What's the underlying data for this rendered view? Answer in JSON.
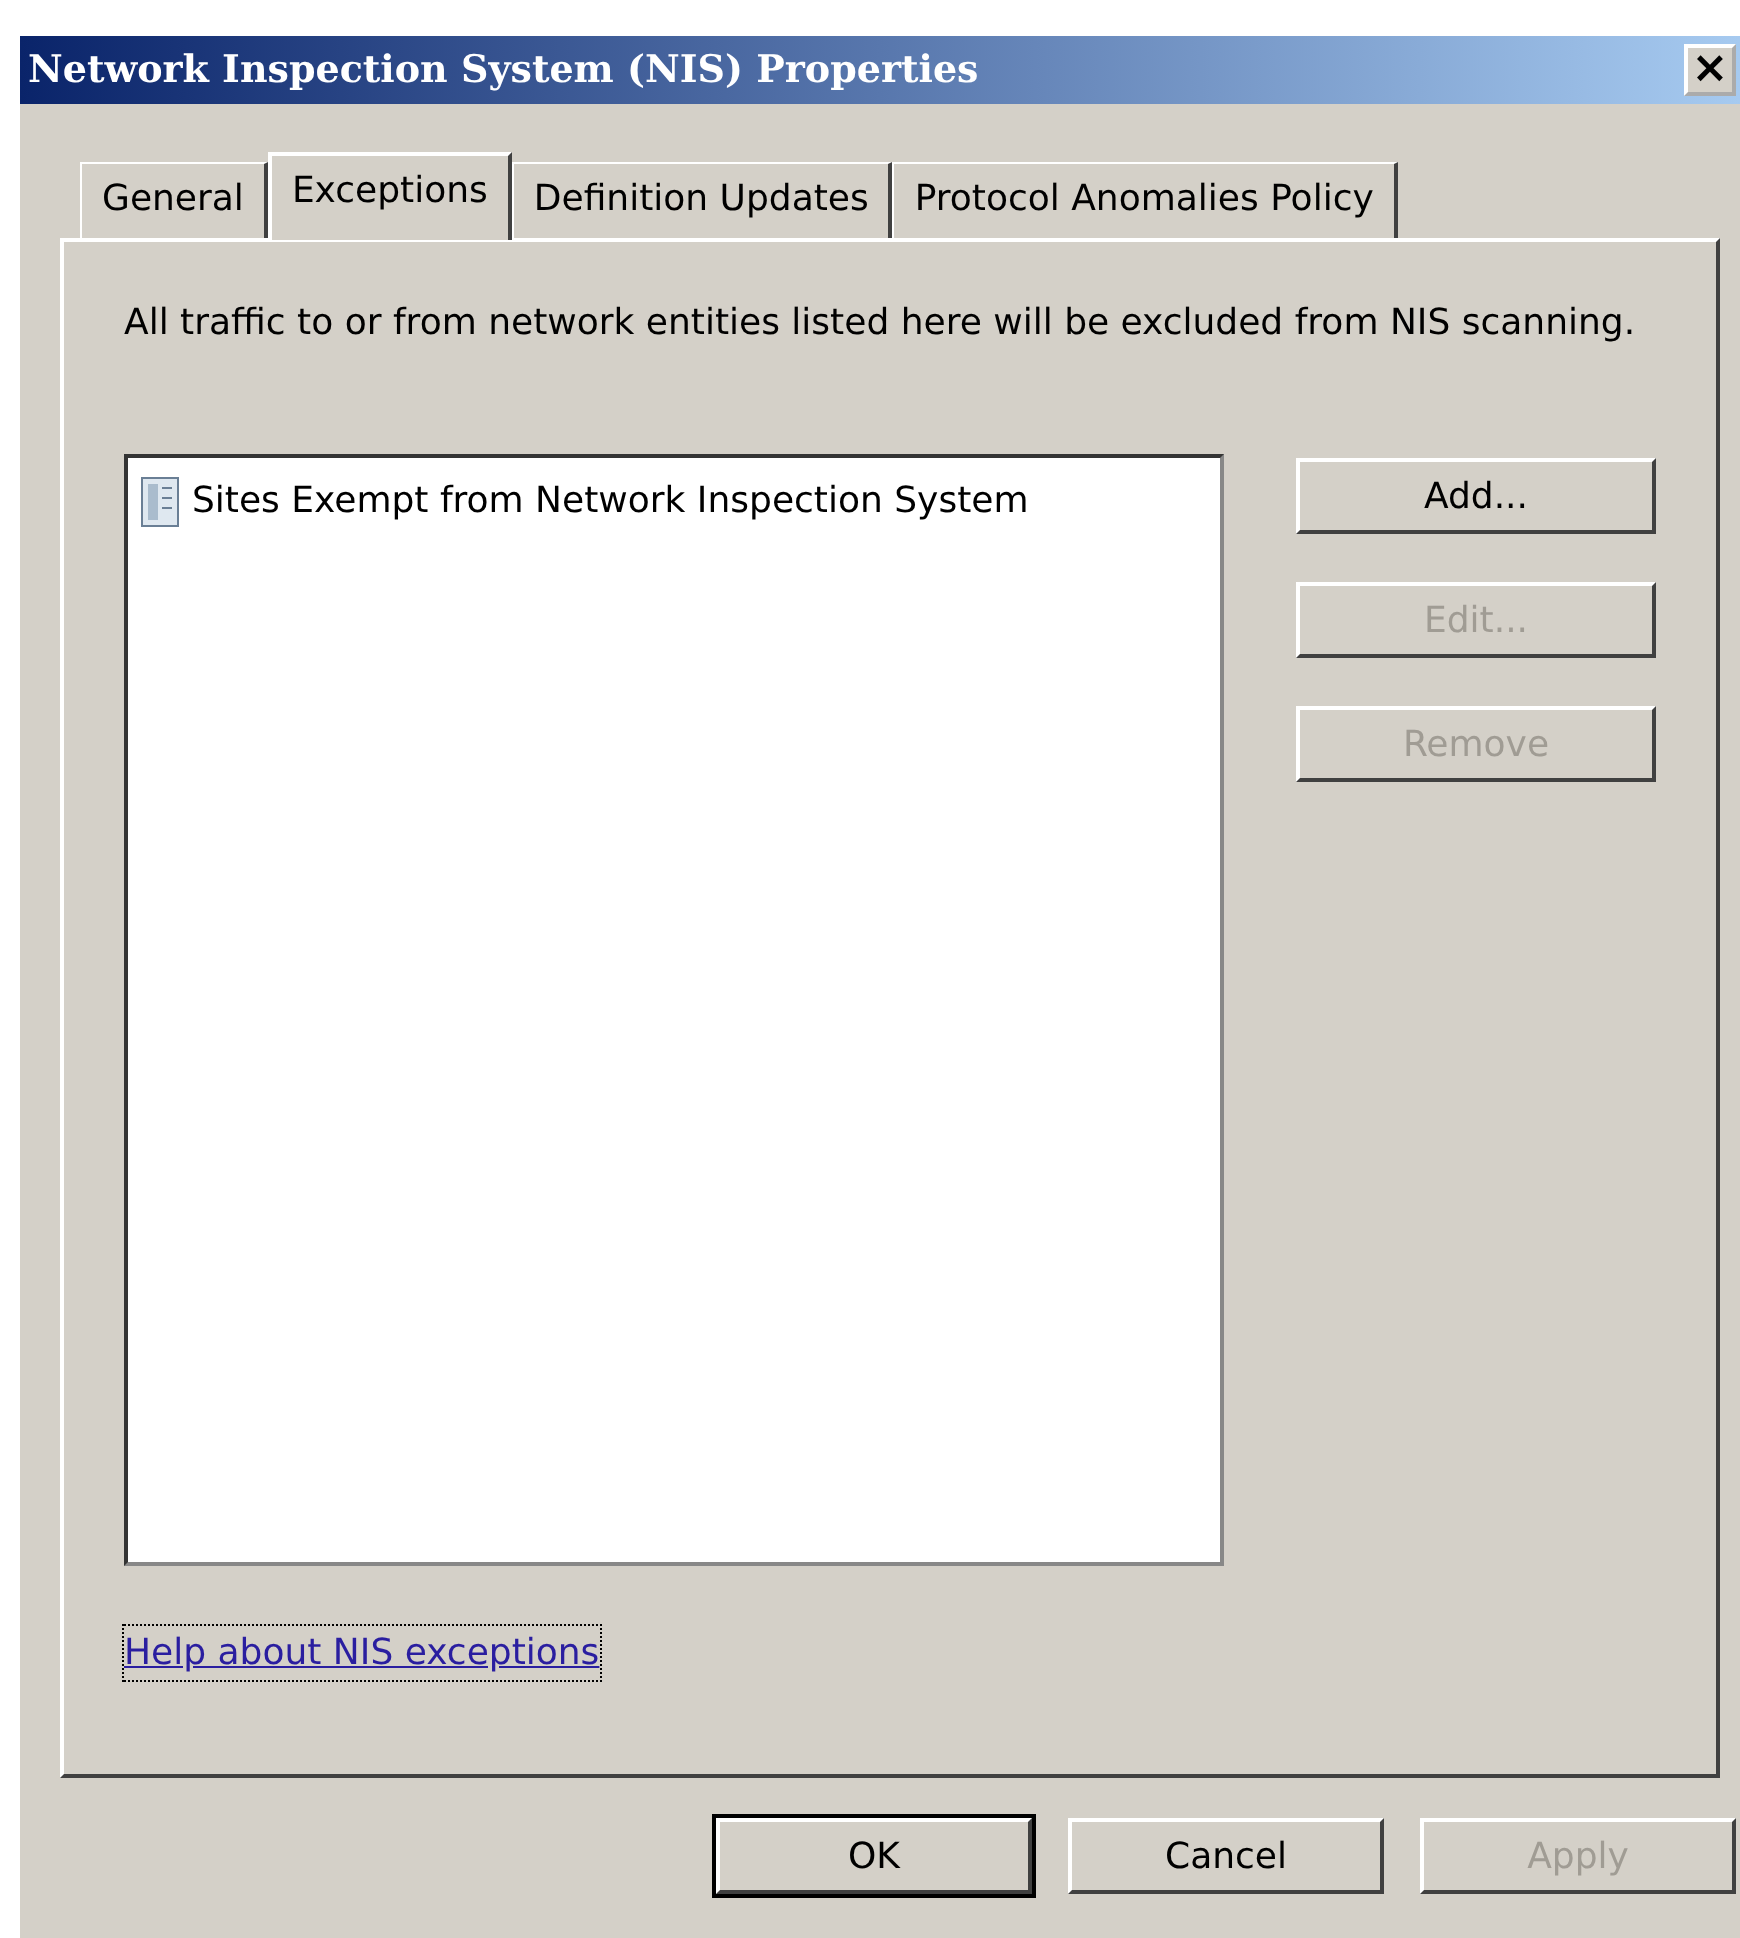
{
  "window": {
    "title": "Network Inspection System (NIS) Properties",
    "close": "×"
  },
  "tabs": [
    {
      "label": "General",
      "selected": false
    },
    {
      "label": "Exceptions",
      "selected": true
    },
    {
      "label": "Definition Updates",
      "selected": false
    },
    {
      "label": "Protocol Anomalies Policy",
      "selected": false
    }
  ],
  "description": "All traffic to or from network entities listed here will be excluded from NIS scanning.",
  "list": {
    "items": [
      {
        "label": "Sites Exempt from Network Inspection System"
      }
    ]
  },
  "side_buttons": [
    {
      "label": "Add...",
      "disabled": false
    },
    {
      "label": "Edit...",
      "disabled": true
    },
    {
      "label": "Remove",
      "disabled": true
    }
  ],
  "help_link": {
    "label": "Help about NIS exceptions",
    "focused": true
  },
  "footer_buttons": [
    {
      "label": "OK",
      "disabled": false,
      "default": true
    },
    {
      "label": "Cancel",
      "disabled": false,
      "default": false
    },
    {
      "label": "Apply",
      "disabled": true,
      "default": false
    }
  ]
}
